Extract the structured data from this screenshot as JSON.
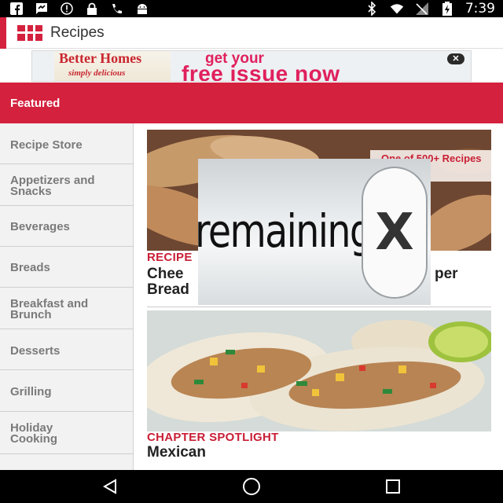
{
  "status_bar": {
    "time": "7:39",
    "left_icons": [
      "fb-icon",
      "message-icon",
      "alert-icon",
      "lock-icon",
      "phone-icon",
      "android-icon"
    ],
    "right_icons": [
      "bluetooth-icon",
      "wifi-icon",
      "signal-icon",
      "battery-icon"
    ]
  },
  "app_bar": {
    "title": "Recipes"
  },
  "ad": {
    "magazine_title_1": "Better",
    "magazine_title_2": "Homes",
    "magazine_sub": "simply delicious",
    "line1": "get your",
    "line2": "free issue now",
    "close_label": "✕"
  },
  "featured": {
    "label": "Featured"
  },
  "sidebar": {
    "items": [
      {
        "label": "Recipe Store"
      },
      {
        "label": "Appetizers and Snacks"
      },
      {
        "label": "Beverages"
      },
      {
        "label": "Breads"
      },
      {
        "label": "Breakfast and Brunch"
      },
      {
        "label": "Desserts"
      },
      {
        "label": "Grilling"
      },
      {
        "label": "Holiday Cooking"
      }
    ]
  },
  "cards": [
    {
      "kicker": "RECIPE",
      "title_left": "Chee",
      "title_right": "per",
      "title_line2": "Bread",
      "badge": "One of 500+ Recipes"
    },
    {
      "kicker": "CHAPTER SPOTLIGHT",
      "title": "Mexican"
    }
  ],
  "overlay": {
    "text": "remaining",
    "close_label": "X"
  }
}
